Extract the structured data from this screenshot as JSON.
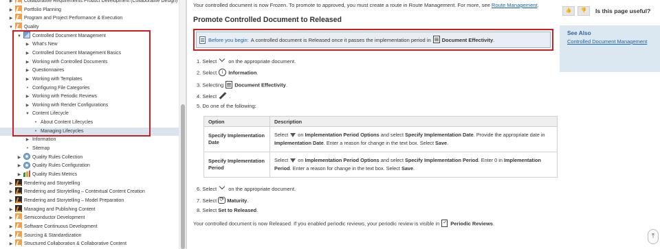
{
  "tree": [
    {
      "label": "Collaborative Requirements Product Development (Collaborative Design)",
      "indent": 1,
      "toggle": "▶",
      "icon": "bk-or"
    },
    {
      "label": "Portfolio Planning",
      "indent": 1,
      "toggle": "▶",
      "icon": "bk-or"
    },
    {
      "label": "Program and Project Performance & Execution",
      "indent": 1,
      "toggle": "▶",
      "icon": "bk-or"
    },
    {
      "label": "Quality",
      "indent": 1,
      "toggle": "▼",
      "icon": "bk-or"
    },
    {
      "label": "Controlled Document Management",
      "indent": 2,
      "toggle": "▼",
      "icon": "app"
    },
    {
      "label": "What's New",
      "indent": 3,
      "toggle": "▶",
      "icon": ""
    },
    {
      "label": "Controlled Document Management Basics",
      "indent": 3,
      "toggle": "▶",
      "icon": ""
    },
    {
      "label": "Working with Controlled Documents",
      "indent": 3,
      "toggle": "▶",
      "icon": ""
    },
    {
      "label": "Questionnaires",
      "indent": 3,
      "toggle": "▶",
      "icon": ""
    },
    {
      "label": "Working with Templates",
      "indent": 3,
      "toggle": "▶",
      "icon": ""
    },
    {
      "label": "Configuring File Categories",
      "indent": 3,
      "toggle": "•",
      "icon": ""
    },
    {
      "label": "Working with Periodic Reviews",
      "indent": 3,
      "toggle": "▶",
      "icon": ""
    },
    {
      "label": "Working with Render Configurations",
      "indent": 3,
      "toggle": "▶",
      "icon": ""
    },
    {
      "label": "Content Lifecycle",
      "indent": 3,
      "toggle": "▼",
      "icon": ""
    },
    {
      "label": "About Content Lifecycles",
      "indent": 4,
      "toggle": "•",
      "icon": ""
    },
    {
      "label": "Managing Lifecycles",
      "indent": 4,
      "toggle": "•",
      "icon": "",
      "selected": true
    },
    {
      "label": "Information",
      "indent": 3,
      "toggle": "▶",
      "icon": ""
    },
    {
      "label": "Sitemap",
      "indent": 3,
      "toggle": "•",
      "icon": ""
    },
    {
      "label": "Quality Rules Collection",
      "indent": 2,
      "toggle": "▶",
      "icon": "gear"
    },
    {
      "label": "Quality Rules Configuration",
      "indent": 2,
      "toggle": "▶",
      "icon": "gear"
    },
    {
      "label": "Quality Rules Metrics",
      "indent": 2,
      "toggle": "▶",
      "icon": "graph"
    },
    {
      "label": "Rendering and Storytelling",
      "indent": 1,
      "toggle": "▶",
      "icon": "bk"
    },
    {
      "label": "Rendering and Storytelling – Contextual Content Creation",
      "indent": 1,
      "toggle": "▶",
      "icon": "bk"
    },
    {
      "label": "Rendering and Storytelling – Model Preparation",
      "indent": 1,
      "toggle": "▶",
      "icon": "bk"
    },
    {
      "label": "Managing and Publishing Content",
      "indent": 1,
      "toggle": "▶",
      "icon": "bk"
    },
    {
      "label": "Semiconductor Development",
      "indent": 1,
      "toggle": "▶",
      "icon": "bk-or"
    },
    {
      "label": "Software Continuous Development",
      "indent": 1,
      "toggle": "▶",
      "icon": "bk-or"
    },
    {
      "label": "Sourcing & Standardization",
      "indent": 1,
      "toggle": "▶",
      "icon": "bk-or"
    },
    {
      "label": "Structured Collaboration & Collaborative Content",
      "indent": 1,
      "toggle": "▶",
      "icon": "bk-or"
    }
  ],
  "content": {
    "intro_text": "Your controlled document is now Frozen. To promote to approved, you must create a route in Route Management. For more, see ",
    "intro_link": "Route Management",
    "intro_end": ".",
    "title": "Promote Controlled Document to Released",
    "note_prefix": "Before you begin:",
    "note_text": " A controlled document is Released once it passes the implementation period in ",
    "note_bold": "Document Effectivity",
    "note_end": ".",
    "steps": {
      "s1a": "1. Select",
      "s1b": "on the appropriate document.",
      "s2a": "2. Select",
      "s2b": "Information",
      "s2c": ".",
      "s3a": "3. Selecting",
      "s3b": "Document Effectivity",
      "s3c": ".",
      "s4a": "4. Select",
      "s4b": ".",
      "s5": "5. Do one of the following:",
      "s6a": "6. Select",
      "s6b": "on the appropriate document.",
      "s7a": "7. Select",
      "s7b": "Maturity",
      "s7c": ".",
      "s8a": "8. Select ",
      "s8b": "Set to Released",
      "s8c": "."
    },
    "table": {
      "col_option": "Option",
      "col_description": "Description",
      "rows": [
        {
          "option": "Specify Implementation Date",
          "d1": "Select",
          "d2": "on",
          "d3": "Implementation Period Options",
          "d4": " and select ",
          "d5": "Specify Implementation Date",
          "d6": ". Provide the appropriate date in ",
          "d7": "Implementation Date",
          "d8": ". Enter a reason for change in the text box. Select ",
          "d9": "Save",
          "d10": "."
        },
        {
          "option": "Specify Implementation Period",
          "d1": "Select",
          "d2": "on",
          "d3": "Implementation Period Options",
          "d4": " and select ",
          "d5": "Specify Implementation Period",
          "d6": ". Enter 0 in ",
          "d7": "Implementation Period",
          "d8": ". Enter a reason for change in the text box. Select ",
          "d9": "Save",
          "d10": "."
        }
      ]
    },
    "outro_text": "Your controlled document is now Released. If you enabled periodic reviews, your periodic review is visible in",
    "outro_bold": "Periodic Reviews",
    "outro_end": "."
  },
  "sidebar": {
    "useful_question": "Is this page useful?",
    "see_also_title": "See Also",
    "see_also_link": "Controlled Document Management"
  },
  "colors": {
    "highlight_border": "#d01c1f",
    "link": "#1a62a6",
    "selected_row": "#d9e4ee",
    "see_also_bg": "#dce8f1"
  }
}
